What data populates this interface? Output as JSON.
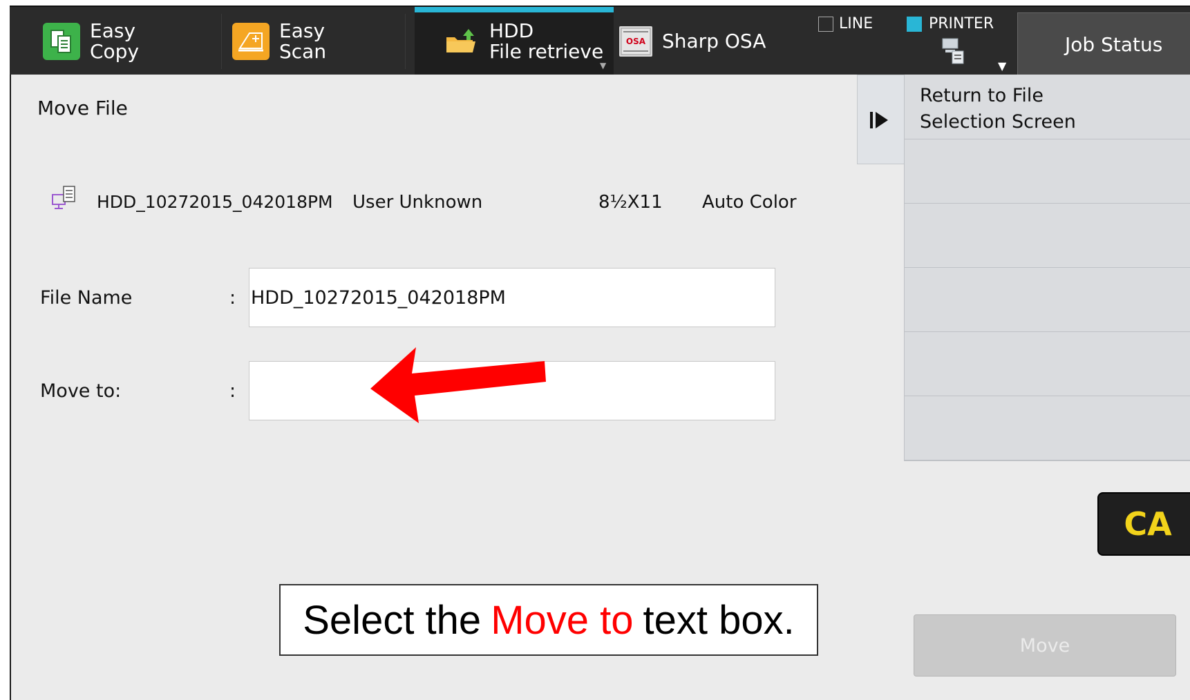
{
  "topbar": {
    "tabs": [
      {
        "line1": "Easy",
        "line2": "Copy"
      },
      {
        "line1": "Easy",
        "line2": "Scan"
      },
      {
        "line1": "HDD",
        "line2": "File retrieve"
      },
      {
        "line1": "Sharp OSA",
        "line2": ""
      }
    ],
    "osa_icon_text": "OSA",
    "status_line": "LINE",
    "status_printer": "PRINTER",
    "job_status": "Job Status",
    "dropdown_glyph": "▼",
    "accent_color": "#29b6d6"
  },
  "main": {
    "title": "Move File",
    "file_meta": {
      "filename": "HDD_10272015_042018PM",
      "user": "User Unknown",
      "paper": "8½X11",
      "color_mode": "Auto Color"
    },
    "form": {
      "file_name_label": "File Name",
      "file_name_value": "HDD_10272015_042018PM",
      "move_to_label": "Move to:",
      "move_to_value": "",
      "colon": ":"
    }
  },
  "side_panel": {
    "items": [
      {
        "line1": "Return to File",
        "line2": "Selection Screen"
      },
      {
        "line1": "",
        "line2": ""
      },
      {
        "line1": "",
        "line2": ""
      },
      {
        "line1": "",
        "line2": ""
      },
      {
        "line1": "",
        "line2": ""
      },
      {
        "line1": "",
        "line2": ""
      }
    ]
  },
  "buttons": {
    "ca": "CA",
    "move": "Move"
  },
  "instruction": {
    "before": "Select the",
    "highlight": "Move to",
    "after": "text box."
  }
}
